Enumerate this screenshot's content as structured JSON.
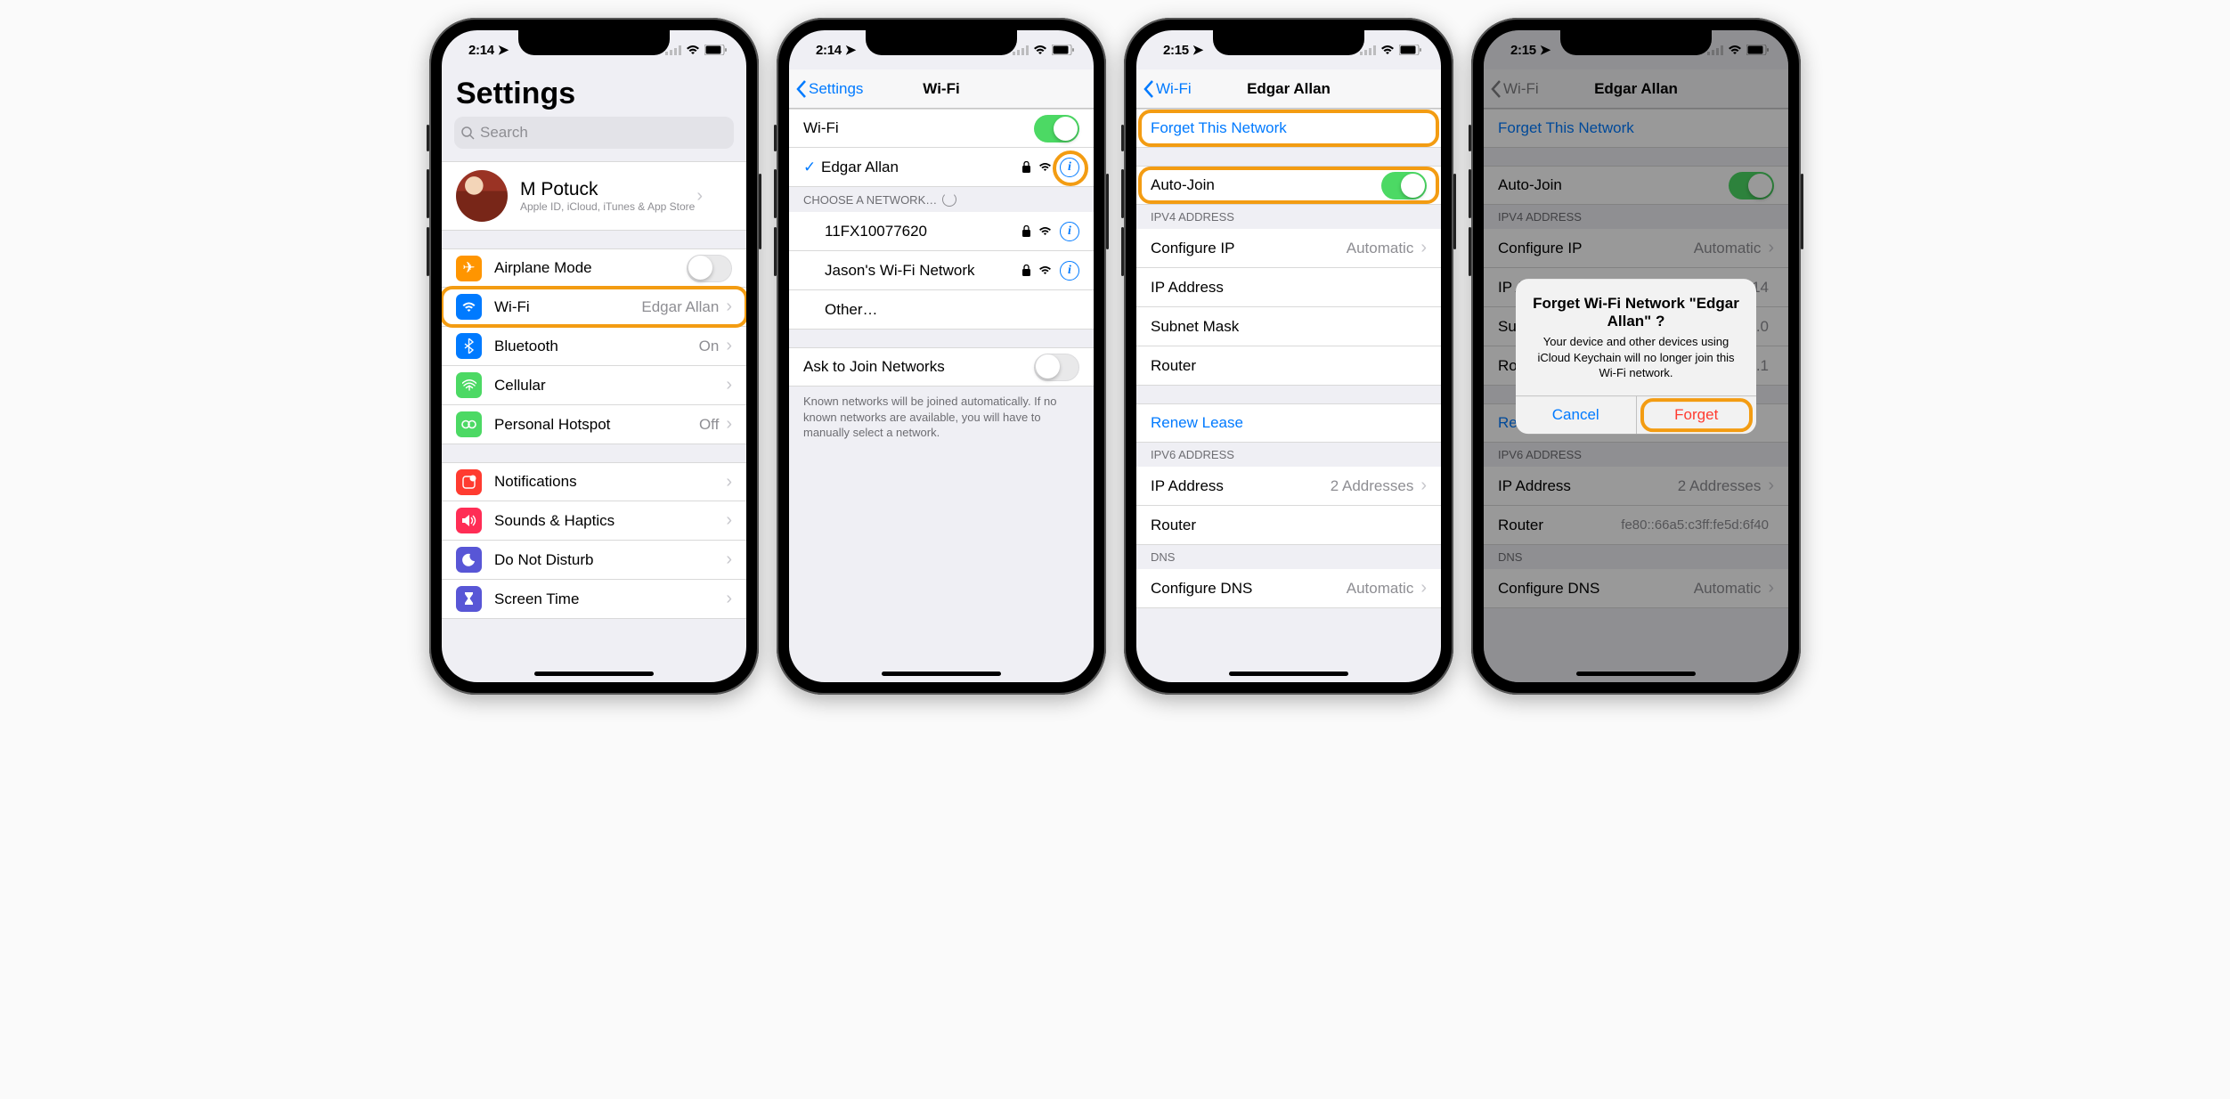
{
  "status": {
    "time1": "2:14",
    "time2": "2:15",
    "loc": "➤"
  },
  "phone1": {
    "title": "Settings",
    "search_placeholder": "Search",
    "profile": {
      "name": "M Potuck",
      "sub": "Apple ID, iCloud, iTunes & App Store"
    },
    "rows": {
      "airplane": "Airplane Mode",
      "wifi": "Wi-Fi",
      "wifi_val": "Edgar Allan",
      "bt": "Bluetooth",
      "bt_val": "On",
      "cell": "Cellular",
      "hotspot": "Personal Hotspot",
      "hotspot_val": "Off",
      "notif": "Notifications",
      "sounds": "Sounds & Haptics",
      "dnd": "Do Not Disturb",
      "screentime": "Screen Time"
    }
  },
  "phone2": {
    "back": "Settings",
    "title": "Wi-Fi",
    "wifi": "Wi-Fi",
    "connected": "Edgar Allan",
    "choose": "CHOOSE A NETWORK…",
    "networks": [
      "11FX10077620",
      "Jason's Wi-Fi Network",
      "Other…"
    ],
    "ask": "Ask to Join Networks",
    "note": "Known networks will be joined automatically. If no known networks are available, you will have to manually select a network."
  },
  "phone3": {
    "back": "Wi-Fi",
    "title": "Edgar Allan",
    "forget": "Forget This Network",
    "autojoin": "Auto-Join",
    "ipv4": "IPV4 ADDRESS",
    "configip": "Configure IP",
    "configip_val": "Automatic",
    "ipaddr": "IP Address",
    "subnet": "Subnet Mask",
    "router": "Router",
    "renew": "Renew Lease",
    "ipv6": "IPV6 ADDRESS",
    "ipv6addr": "IP Address",
    "ipv6val": "2 Addresses",
    "dns": "DNS",
    "configdns": "Configure DNS",
    "configdns_val": "Automatic"
  },
  "phone4": {
    "back": "Wi-Fi",
    "title": "Edgar Allan",
    "forget": "Forget This Network",
    "autojoin": "Auto-Join",
    "ipv4": "IPV4 ADDRESS",
    "configip": "Configure IP",
    "configip_val": "Automatic",
    "ipaddr": "IP Address",
    "ipaddr_val": "192.168.0.1.14",
    "subnet": "Subnet Mask",
    "subnet_val": "255.0",
    "router": "Router",
    "router_val": "0.1.1",
    "renew": "Renew Lease",
    "ipv6": "IPV6 ADDRESS",
    "ipv6addr": "IP Address",
    "ipv6val": "2 Addresses",
    "ipv6router": "Router",
    "ipv6router_val": "fe80::66a5:c3ff:fe5d:6f40",
    "dns": "DNS",
    "configdns": "Configure DNS",
    "configdns_val": "Automatic",
    "alert": {
      "title": "Forget Wi-Fi Network \"Edgar Allan\" ?",
      "body": "Your device and other devices using iCloud Keychain will no longer join this Wi-Fi network.",
      "cancel": "Cancel",
      "forget": "Forget"
    }
  }
}
